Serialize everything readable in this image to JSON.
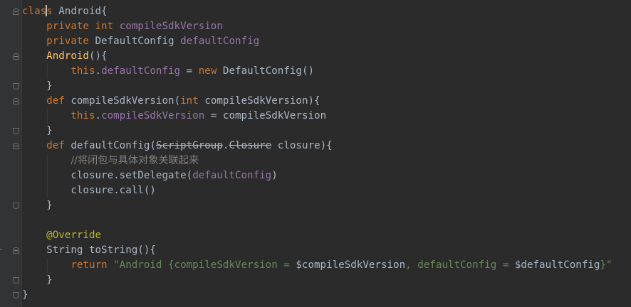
{
  "code": {
    "l1_kw": "clas",
    "l1_kw2": "s",
    "l1_rest": " Android{",
    "l2_kw": "private",
    "l2_type": "int",
    "l2_field": "compileSdkVersion",
    "l3_kw": "private",
    "l3_type": "DefaultConfig",
    "l3_field": "defaultConfig",
    "l4_ctor": "Android",
    "l4_rest": "(){",
    "l5_this": "this",
    "l5_dot": ".",
    "l5_field": "defaultConfig",
    "l5_eq": " = ",
    "l5_new": "new",
    "l5_rest": " DefaultConfig()",
    "l6": "}",
    "l7_def": "def",
    "l7_name": "compileSdkVersion",
    "l7_open": "(",
    "l7_type": "int",
    "l7_rest": " compileSdkVersion){",
    "l8_this": "this",
    "l8_dot": ".",
    "l8_field": "compileSdkVersion",
    "l8_rest": " = compileSdkVersion",
    "l9": "}",
    "l10_def": "def",
    "l10_name": "defaultConfig",
    "l10_open": "(",
    "l10_depr1": "ScriptGroup",
    "l10_dot": ".",
    "l10_depr2": "Closure",
    "l10_rest": " closure){",
    "l11_comment": "//将闭包与具体对象关联起来",
    "l12_pre": "closure.setDelegate(",
    "l12_field": "defaultConfig",
    "l12_post": ")",
    "l13": "closure.call()",
    "l14": "}",
    "l16_ann": "@Override",
    "l17": "String toString(){",
    "l18_ret": "return",
    "l18_s1": " \"Android {compileSdkVersion = ",
    "l18_v1": "$compileSdkVersion",
    "l18_s2": ", defaultConfig = ",
    "l18_v2": "$defaultConfig",
    "l18_s3": "}\"",
    "l19": "}",
    "l20": "}"
  }
}
